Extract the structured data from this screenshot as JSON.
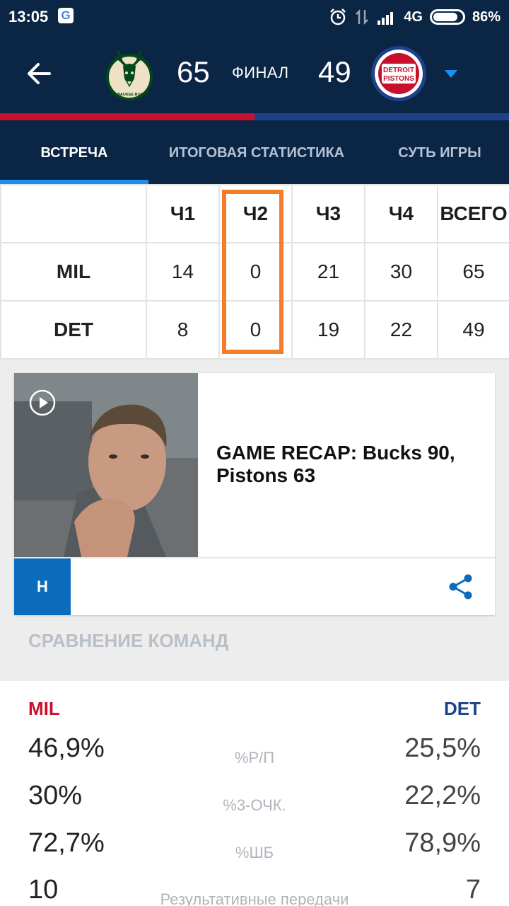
{
  "status_bar": {
    "time": "13:05",
    "network": "4G",
    "battery": "86%",
    "battery_level": 0.86
  },
  "header": {
    "home_score": "65",
    "game_status": "ФИНАЛ",
    "away_score": "49",
    "home_logo_text": "MILWAUKEE BUCKS",
    "away_logo_text_1": "DETROIT",
    "away_logo_text_2": "PISTONS",
    "split_home_fraction": 0.5
  },
  "tabs": [
    {
      "label": "ВСТРЕЧА",
      "active": true
    },
    {
      "label": "ИТОГОВАЯ СТАТИСТИКА",
      "active": false
    },
    {
      "label": "СУТЬ ИГРЫ",
      "active": false
    }
  ],
  "linescore": {
    "headers": [
      "",
      "Ч1",
      "Ч2",
      "Ч3",
      "Ч4",
      "ВСЕГО"
    ],
    "rows": [
      {
        "team": "MIL",
        "q": [
          "14",
          "0",
          "21",
          "30",
          "65"
        ]
      },
      {
        "team": "DET",
        "q": [
          "8",
          "0",
          "19",
          "22",
          "49"
        ]
      }
    ]
  },
  "video_card": {
    "title": "GAME RECAP: Bucks 90, Pistons 63",
    "source_badge": "H"
  },
  "comparison": {
    "section_title": "СРАВНЕНИЕ КОМАНД",
    "home_team": "MIL",
    "away_team": "DET",
    "stats": [
      {
        "label": "%Р/П",
        "home": "46,9%",
        "away": "25,5%"
      },
      {
        "label": "%3-ОЧК.",
        "home": "30%",
        "away": "22,2%"
      },
      {
        "label": "%ШБ",
        "home": "72,7%",
        "away": "78,9%"
      },
      {
        "label": "Результативные передачи",
        "home": "10",
        "away": "7"
      }
    ]
  },
  "colors": {
    "header_bg": "#0b2545",
    "home_accent": "#c8102e",
    "away_accent": "#1d428a",
    "tab_indicator": "#1a8ff0",
    "highlight": "#f47c2a"
  }
}
